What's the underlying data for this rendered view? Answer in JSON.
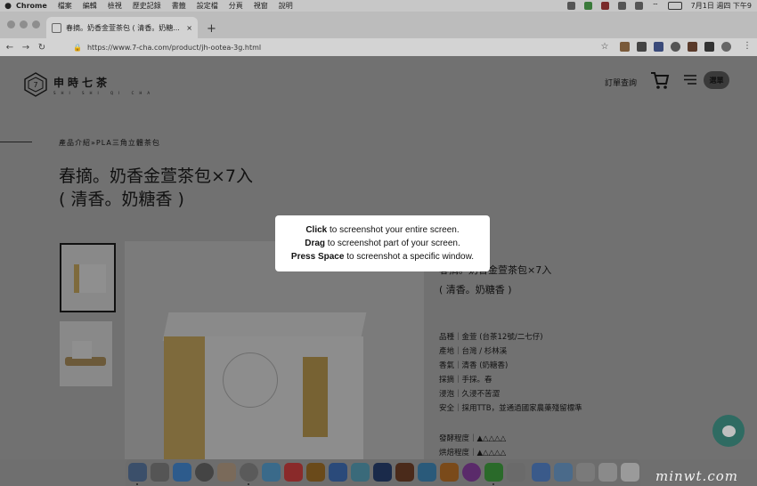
{
  "menubar": {
    "items": [
      "Chrome",
      "檔案",
      "編輯",
      "檢視",
      "歷史記錄",
      "書籤",
      "設定檔",
      "分頁",
      "視窗",
      "說明"
    ],
    "clock": "7月1日 週四 下午9"
  },
  "browser": {
    "tab_title": "春摘。奶香金萱茶包 ( 清香。奶糖...",
    "url": "https://www.7-cha.com/product/jh-ootea-3g.html"
  },
  "site": {
    "logo_text": "申時七茶",
    "logo_sub": "SHI SHI QI CHA",
    "orders_label": "訂單查詢",
    "menu_label": "選單"
  },
  "product": {
    "breadcrumb": "產品介紹»PLA三角立體茶包",
    "title_line1": "春摘。奶香金萱茶包×7入",
    "title_line2": "( 清香。奶糖香 )",
    "info_title_line1": "春摘。奶香金萱茶包×7入",
    "info_title_line2": "( 清香。奶糖香 )",
    "specs": [
      "品種｜金萱 (台茶12號/二七仔)",
      "產地｜台灣 / 杉林溪",
      "香氣｜清香 (奶糖香)",
      "採摘｜手採。春",
      "浸泡｜久浸不苦澀",
      "安全｜採用TTB，並通過國家農藥殘留標準"
    ],
    "levels": [
      "發酵程度｜▲△△△△",
      "烘焙程度｜▲△△△△"
    ]
  },
  "screenshot_overlay": {
    "line1_bold": "Click",
    "line1_rest": " to screenshot your entire screen.",
    "line2_bold": "Drag",
    "line2_rest": " to screenshot part of your screen.",
    "line3_bold": "Press Space",
    "line3_rest": " to screenshot a specific window."
  },
  "watermark": "minwt.com"
}
